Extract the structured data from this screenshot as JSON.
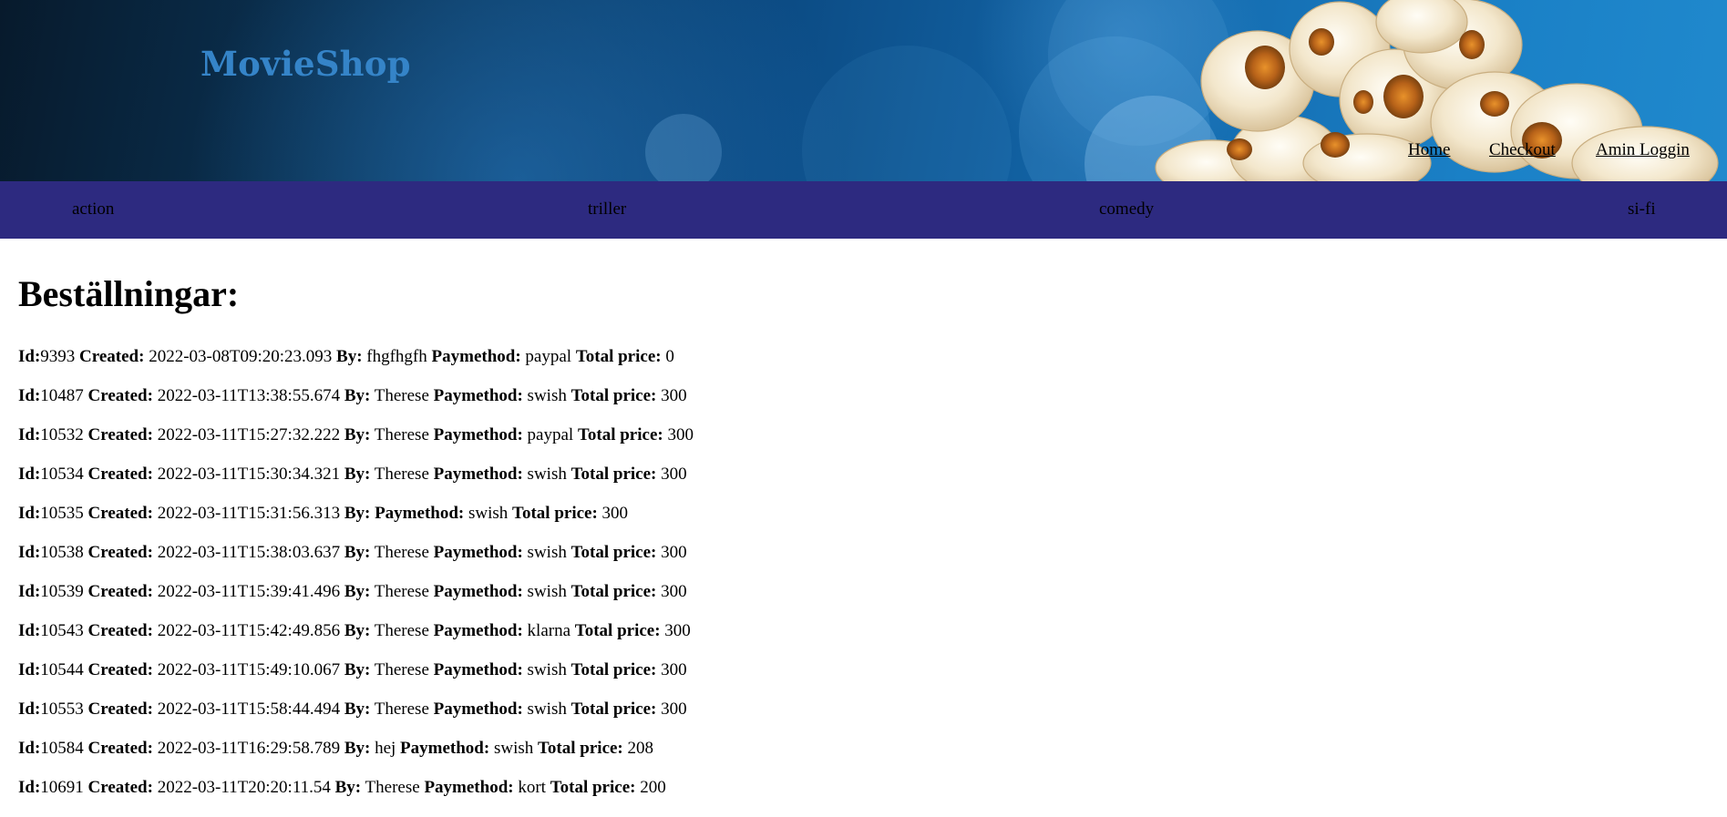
{
  "header": {
    "brand": "MovieShop",
    "nav": [
      {
        "label": "Home"
      },
      {
        "label": "Checkout"
      },
      {
        "label": "Amin Loggin"
      }
    ]
  },
  "categories": [
    {
      "label": "action"
    },
    {
      "label": "triller"
    },
    {
      "label": "comedy"
    },
    {
      "label": "si-fi"
    }
  ],
  "main": {
    "title": "Beställningar:",
    "labels": {
      "id": "Id:",
      "created": "Created:",
      "by": "By:",
      "paymethod": "Paymethod:",
      "total": "Total price:"
    },
    "orders": [
      {
        "id": "9393",
        "created": "2022-03-08T09:20:23.093",
        "by": "fhgfhgfh",
        "paymethod": "paypal",
        "total": "0"
      },
      {
        "id": "10487",
        "created": "2022-03-11T13:38:55.674",
        "by": "Therese",
        "paymethod": "swish",
        "total": "300"
      },
      {
        "id": "10532",
        "created": "2022-03-11T15:27:32.222",
        "by": "Therese",
        "paymethod": "paypal",
        "total": "300"
      },
      {
        "id": "10534",
        "created": "2022-03-11T15:30:34.321",
        "by": "Therese",
        "paymethod": "swish",
        "total": "300"
      },
      {
        "id": "10535",
        "created": "2022-03-11T15:31:56.313",
        "by": "",
        "paymethod": "swish",
        "total": "300"
      },
      {
        "id": "10538",
        "created": "2022-03-11T15:38:03.637",
        "by": "Therese",
        "paymethod": "swish",
        "total": "300"
      },
      {
        "id": "10539",
        "created": "2022-03-11T15:39:41.496",
        "by": "Therese",
        "paymethod": "swish",
        "total": "300"
      },
      {
        "id": "10543",
        "created": "2022-03-11T15:42:49.856",
        "by": "Therese",
        "paymethod": "klarna",
        "total": "300"
      },
      {
        "id": "10544",
        "created": "2022-03-11T15:49:10.067",
        "by": "Therese",
        "paymethod": "swish",
        "total": "300"
      },
      {
        "id": "10553",
        "created": "2022-03-11T15:58:44.494",
        "by": "Therese",
        "paymethod": "swish",
        "total": "300"
      },
      {
        "id": "10584",
        "created": "2022-03-11T16:29:58.789",
        "by": "hej",
        "paymethod": "swish",
        "total": "208"
      },
      {
        "id": "10691",
        "created": "2022-03-11T20:20:11.54",
        "by": "Therese",
        "paymethod": "kort",
        "total": "200"
      }
    ]
  },
  "colors": {
    "brand_text": "#3584c8",
    "category_bar": "#2d2a80",
    "header_dark": "#071a2c",
    "header_light": "#2089cd"
  },
  "icons": {
    "header_image": "popcorn-illustration"
  }
}
